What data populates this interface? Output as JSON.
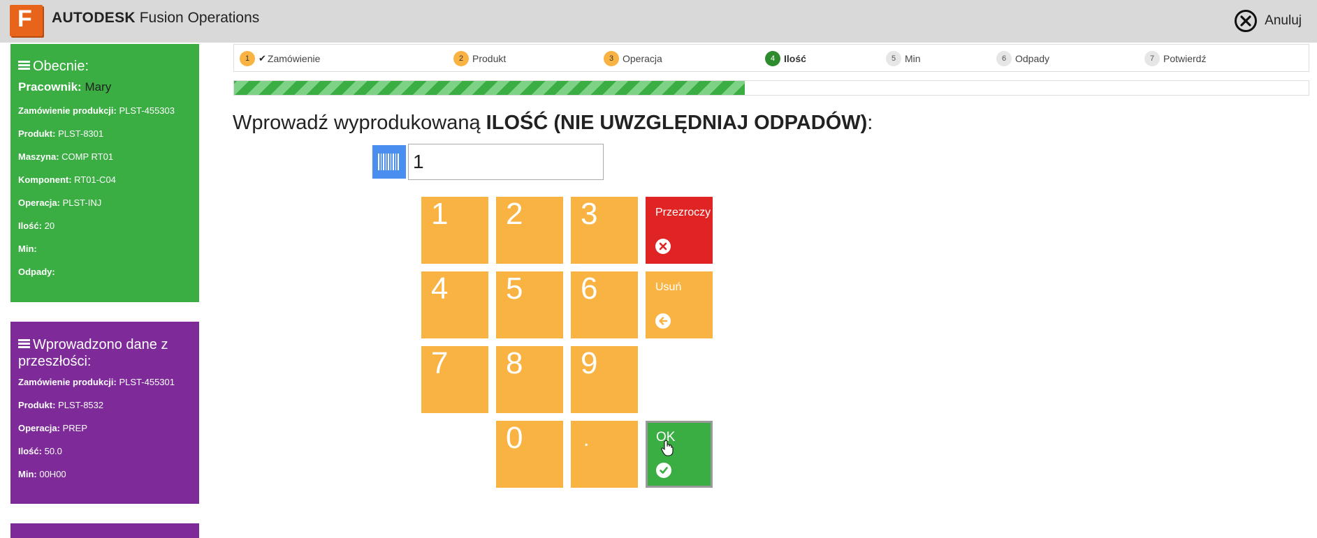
{
  "header": {
    "logo_letter": "F",
    "brand_bold": "AUTODESK",
    "brand_rest": "Fusion Operations",
    "cancel_label": "Anuluj"
  },
  "current_panel": {
    "title": "Obecnie:",
    "worker_label": "Pracownik:",
    "worker_value": "Mary",
    "rows": [
      {
        "label": "Zamówienie produkcji:",
        "value": "PLST-455303"
      },
      {
        "label": "Produkt:",
        "value": "PLST-8301"
      },
      {
        "label": "Maszyna:",
        "value": "COMP RT01"
      },
      {
        "label": "Komponent:",
        "value": "RT01-C04"
      },
      {
        "label": "Operacja:",
        "value": "PLST-INJ"
      },
      {
        "label": "Ilość:",
        "value": "20"
      },
      {
        "label": "Min:",
        "value": ""
      },
      {
        "label": "Odpady:",
        "value": ""
      }
    ]
  },
  "past_panel": {
    "title": "Wprowadzono dane z przeszłości:",
    "rows": [
      {
        "label": "Zamówienie produkcji:",
        "value": "PLST-455301"
      },
      {
        "label": "Produkt:",
        "value": "PLST-8532"
      },
      {
        "label": "Operacja:",
        "value": "PREP"
      },
      {
        "label": "Ilość:",
        "value": "50.0"
      },
      {
        "label": "Min:",
        "value": "00H00"
      }
    ]
  },
  "steps": [
    {
      "num": "1",
      "label": "Zamówienie",
      "state": "done"
    },
    {
      "num": "2",
      "label": "Produkt",
      "state": "orange"
    },
    {
      "num": "3",
      "label": "Operacja",
      "state": "orange"
    },
    {
      "num": "4",
      "label": "Ilość",
      "state": "active"
    },
    {
      "num": "5",
      "label": "Min",
      "state": "todo"
    },
    {
      "num": "6",
      "label": "Odpady",
      "state": "todo"
    },
    {
      "num": "7",
      "label": "Potwierdź",
      "state": "todo"
    }
  ],
  "progress_fraction": 0.475,
  "prompt": {
    "prefix": "Wprowadź wyprodukowaną ",
    "emphasis": "ILOŚĆ (NIE UWZGLĘDNIAJ ODPADÓW)",
    "suffix": ":"
  },
  "quantity_input": {
    "value": "1"
  },
  "keypad": {
    "digits": [
      "1",
      "2",
      "3",
      "4",
      "5",
      "6",
      "7",
      "8",
      "9",
      "0",
      "."
    ],
    "clear_label": "Przezroczy",
    "delete_label": "Usuń",
    "ok_label": "OK"
  },
  "colors": {
    "green": "#3aad43",
    "purple": "#7e2b99",
    "orange": "#f9b342",
    "red": "#e02424",
    "barcode_blue": "#4a8ef0"
  }
}
